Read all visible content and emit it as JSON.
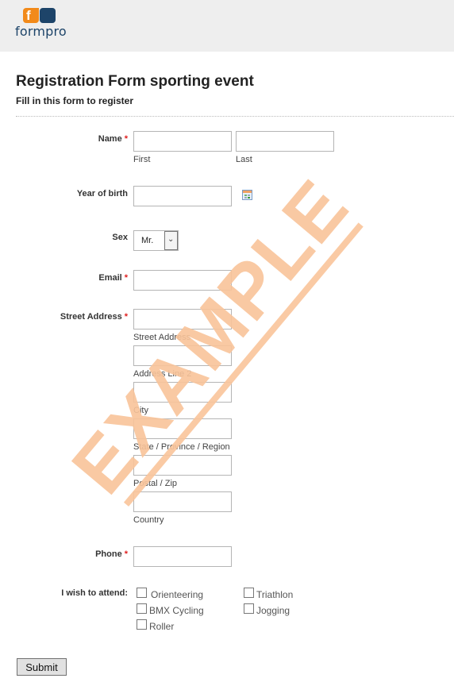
{
  "header": {
    "brand": "formpro",
    "logo_letter": "f",
    "colors": {
      "orange": "#f28a1a",
      "navy": "#1d4469"
    }
  },
  "form": {
    "title": "Registration Form sporting event",
    "subtitle": "Fill in this form to register",
    "required_marker": "*",
    "fields": {
      "name": {
        "label": "Name",
        "required": true,
        "first_sublabel": "First",
        "last_sublabel": "Last",
        "first_value": "",
        "last_value": ""
      },
      "year_of_birth": {
        "label": "Year of birth",
        "required": false,
        "value": "",
        "icon": "calendar-icon"
      },
      "sex": {
        "label": "Sex",
        "required": false,
        "selected": "Mr.",
        "arrow": "⌄"
      },
      "email": {
        "label": "Email",
        "required": true,
        "value": ""
      },
      "address": {
        "label": "Street Address",
        "required": true,
        "sublabels": [
          "Street Address",
          "Address Line 2",
          "City",
          "State / Province / Region",
          "Postal / Zip",
          "Country"
        ]
      },
      "phone": {
        "label": "Phone",
        "required": true,
        "value": ""
      },
      "attend": {
        "label": "I wish to attend:",
        "options": [
          {
            "label": "Orienteering",
            "checked": false
          },
          {
            "label": "Triathlon",
            "checked": false
          },
          {
            "label": "BMX Cycling",
            "checked": false
          },
          {
            "label": "Jogging",
            "checked": false
          },
          {
            "label": "Roller",
            "checked": false
          }
        ]
      }
    },
    "submit_label": "Submit"
  },
  "watermark": {
    "text": "EXAMPLE",
    "color": "#f9c49a"
  }
}
